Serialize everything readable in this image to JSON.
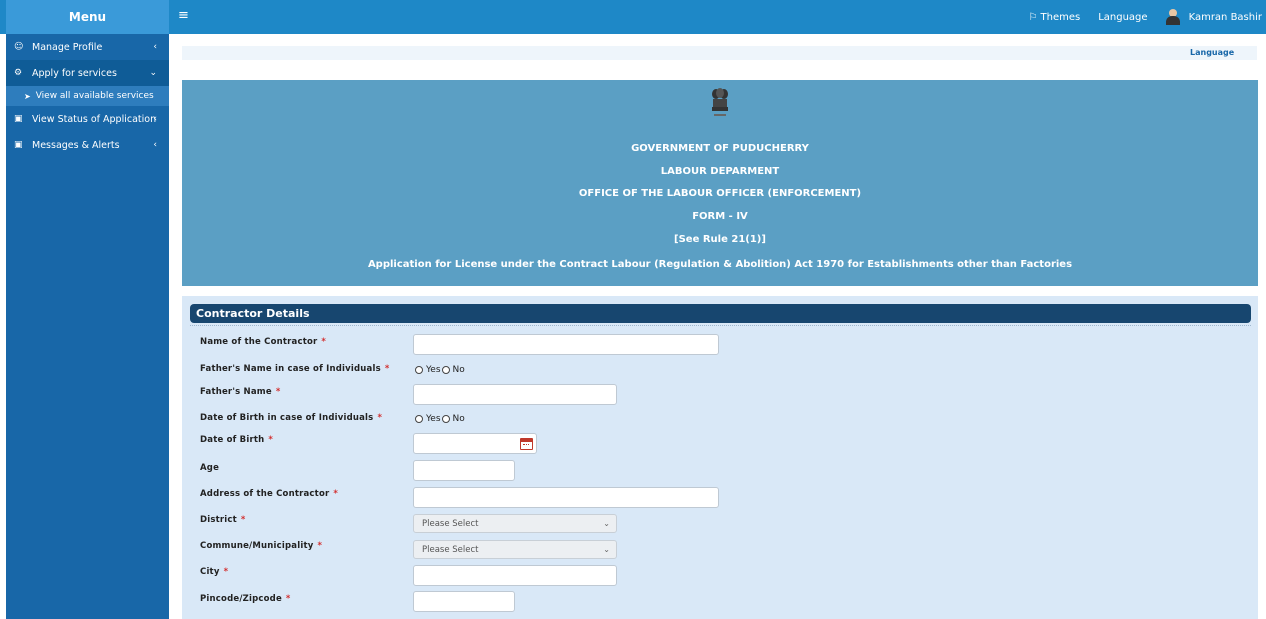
{
  "header": {
    "menu_title": "Menu",
    "menu_toggle_icon": "hamburger-icon",
    "themes_label": "Themes",
    "language_label": "Language",
    "user_name": "Kamran Bashir"
  },
  "sidebar": {
    "items": [
      {
        "label": "Manage Profile",
        "icon": "users-icon"
      },
      {
        "label": "Apply for services",
        "icon": "cogs-icon"
      },
      {
        "label": "View all available services",
        "icon": "circle-arrow-icon"
      },
      {
        "label": "View Status of Application",
        "icon": "window-icon"
      },
      {
        "label": "Messages & Alerts",
        "icon": "window-icon"
      }
    ]
  },
  "content": {
    "language_link": "Language"
  },
  "banner": {
    "line1": "GOVERNMENT OF PUDUCHERRY",
    "line2": "LABOUR DEPARMENT",
    "line3": "OFFICE OF THE LABOUR OFFICER (ENFORCEMENT)",
    "line4": "FORM - IV",
    "line5": "[See Rule 21(1)]",
    "line6": "Application for License under the Contract Labour (Regulation & Abolition) Act 1970 for Establishments other than Factories"
  },
  "form": {
    "section_title": "Contractor Details",
    "required_mark": "*",
    "fields": {
      "contractor_name": "Name of the Contractor",
      "father_name_toggle": "Father's Name in case of Individuals",
      "father_name": "Father's Name",
      "dob_toggle": "Date of Birth in case of Individuals",
      "dob": "Date of Birth",
      "age": "Age",
      "address": "Address of the Contractor",
      "district": "District",
      "commune": "Commune/Municipality",
      "city": "City",
      "pincode": "Pincode/Zipcode"
    },
    "radio_yes": "Yes",
    "radio_no": "No",
    "select_placeholder": "Please Select"
  }
}
